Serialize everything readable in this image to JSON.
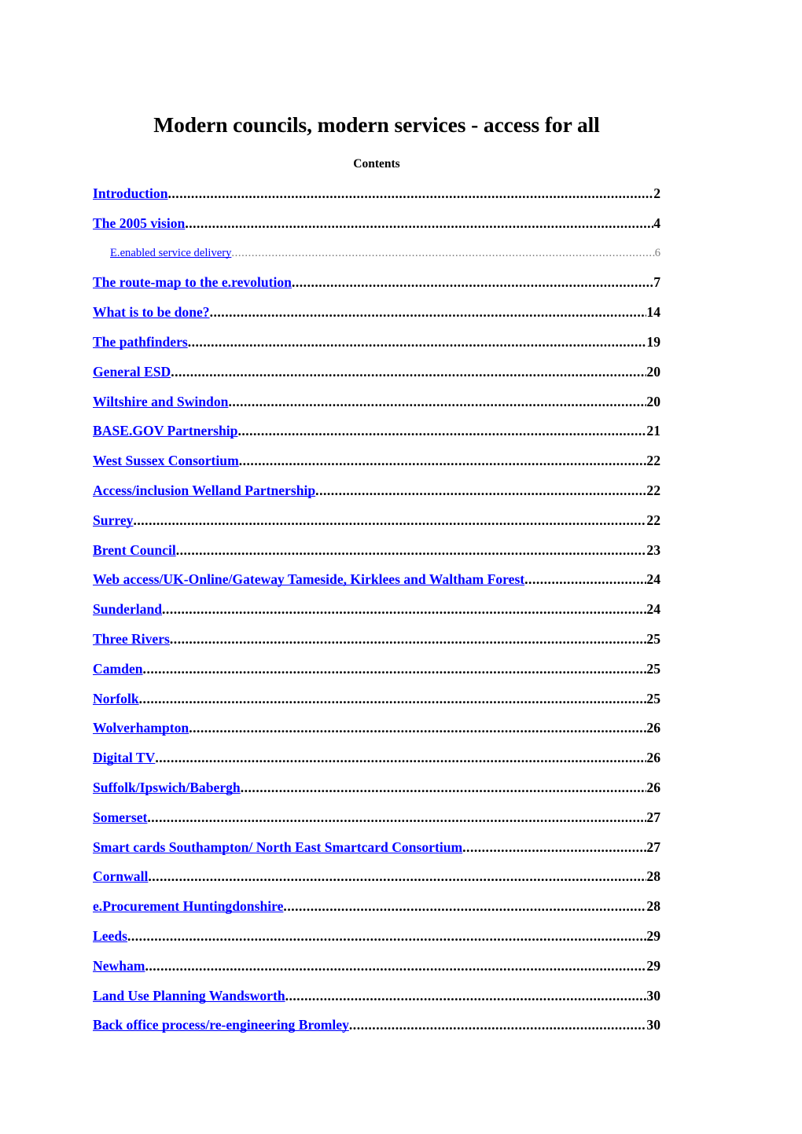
{
  "document": {
    "title": "Modern councils, modern services - access for all",
    "contents_heading": "Contents",
    "link_color": "#0000ff",
    "page_number_color": "#000000",
    "subentry_color": "#7b7b7b"
  },
  "toc": {
    "entries": [
      {
        "label": "Introduction",
        "page": "2",
        "level": 1
      },
      {
        "label": "The 2005 vision",
        "page": "4",
        "level": 1
      },
      {
        "label": "E.enabled service delivery",
        "page": "6",
        "level": 2
      },
      {
        "label": "The route-map to the e.revolution",
        "page": "7",
        "level": 1
      },
      {
        "label": "What is to be done?",
        "page": "14",
        "level": 1
      },
      {
        "label": "The pathfinders",
        "page": "19",
        "level": 1
      },
      {
        "label": "General ESD",
        "page": "20",
        "level": 1
      },
      {
        "label": "Wiltshire and Swindon",
        "page": "20",
        "level": 1
      },
      {
        "label": "BASE.GOV Partnership",
        "page": "21",
        "level": 1
      },
      {
        "label": "West Sussex Consortium",
        "page": "22",
        "level": 1
      },
      {
        "label": "Access/inclusion  Welland Partnership",
        "page": "22",
        "level": 1
      },
      {
        "label": "Surrey",
        "page": "22",
        "level": 1
      },
      {
        "label": "Brent Council",
        "page": "23",
        "level": 1
      },
      {
        "label": "Web access/UK-Online/Gateway  Tameside, Kirklees and Waltham Forest",
        "page": "24",
        "level": 1
      },
      {
        "label": "Sunderland",
        "page": "24",
        "level": 1
      },
      {
        "label": "Three Rivers",
        "page": "25",
        "level": 1
      },
      {
        "label": "Camden",
        "page": "25",
        "level": 1
      },
      {
        "label": "Norfolk",
        "page": "25",
        "level": 1
      },
      {
        "label": "Wolverhampton",
        "page": "26",
        "level": 1
      },
      {
        "label": "Digital TV",
        "page": "26",
        "level": 1
      },
      {
        "label": "Suffolk/Ipswich/Babergh",
        "page": "26",
        "level": 1
      },
      {
        "label": "Somerset",
        "page": "27",
        "level": 1
      },
      {
        "label": "Smart cards  Southampton/ North East Smartcard Consortium",
        "page": "27",
        "level": 1
      },
      {
        "label": "Cornwall",
        "page": "28",
        "level": 1
      },
      {
        "label": "e.Procurement  Huntingdonshire",
        "page": "28",
        "level": 1
      },
      {
        "label": "Leeds",
        "page": "29",
        "level": 1
      },
      {
        "label": "Newham",
        "page": "29",
        "level": 1
      },
      {
        "label": "Land Use Planning  Wandsworth",
        "page": "30",
        "level": 1
      },
      {
        "label": "Back office process/re-engineering  Bromley",
        "page": "30",
        "level": 1
      }
    ]
  }
}
